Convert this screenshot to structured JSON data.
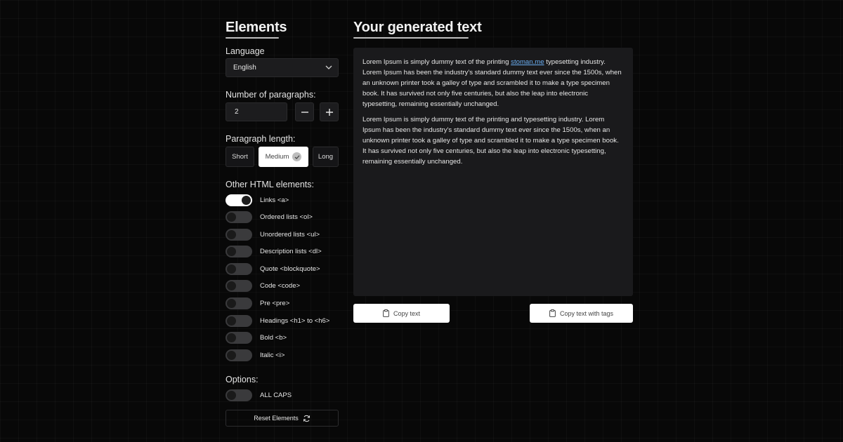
{
  "sidebar": {
    "title": "Elements",
    "language": {
      "label": "Language",
      "value": "English"
    },
    "paragraphs": {
      "label": "Number of paragraphs:",
      "value": "2",
      "minus": "−",
      "plus": "+"
    },
    "length": {
      "label": "Paragraph length:",
      "options": [
        "Short",
        "Medium",
        "Long"
      ],
      "selected": "Medium"
    },
    "html_elements": {
      "label": "Other HTML elements:",
      "items": [
        {
          "label": "Links <a>",
          "on": true
        },
        {
          "label": "Ordered lists <ol>",
          "on": false
        },
        {
          "label": "Unordered lists <ul>",
          "on": false
        },
        {
          "label": "Description lists <dl>",
          "on": false
        },
        {
          "label": "Quote <blockquote>",
          "on": false
        },
        {
          "label": "Code <code>",
          "on": false
        },
        {
          "label": "Pre <pre>",
          "on": false
        },
        {
          "label": "Headings <h1> to <h6>",
          "on": false
        },
        {
          "label": "Bold <b>",
          "on": false
        },
        {
          "label": "Italic <i>",
          "on": false
        }
      ]
    },
    "options": {
      "label": "Options:",
      "items": [
        {
          "label": "ALL CAPS",
          "on": false
        }
      ]
    },
    "reset_label": "Reset Elements"
  },
  "main": {
    "title": "Your generated text",
    "paragraph1": {
      "before": "Lorem Ipsum is simply dummy text of the printing ",
      "link": "stoman.me",
      "after": " typesetting industry. Lorem Ipsum has been the industry's standard dummy text ever since the 1500s, when an unknown printer took a galley of type and scrambled it to make a type specimen book. It has survived not only five centuries, but also the leap into electronic typesetting, remaining essentially unchanged."
    },
    "paragraph2": "Lorem Ipsum is simply dummy text of the printing and typesetting industry. Lorem Ipsum has been the industry's standard dummy text ever since the 1500s, when an unknown printer took a galley of type and scrambled it to make a type specimen book. It has survived not only five centuries, but also the leap into electronic typesetting, remaining essentially unchanged.",
    "copy_text_label": "Copy text",
    "copy_tags_label": "Copy text with tags"
  },
  "colors": {
    "background": "#080808",
    "panel": "#1a1a1c",
    "link": "#6aaef2",
    "toggle_on": "#ffffff",
    "toggle_off": "#3a3a3c"
  },
  "icons": [
    "chevron-down-icon",
    "minus-icon",
    "plus-icon",
    "check-icon",
    "refresh-icon",
    "clipboard-icon"
  ]
}
